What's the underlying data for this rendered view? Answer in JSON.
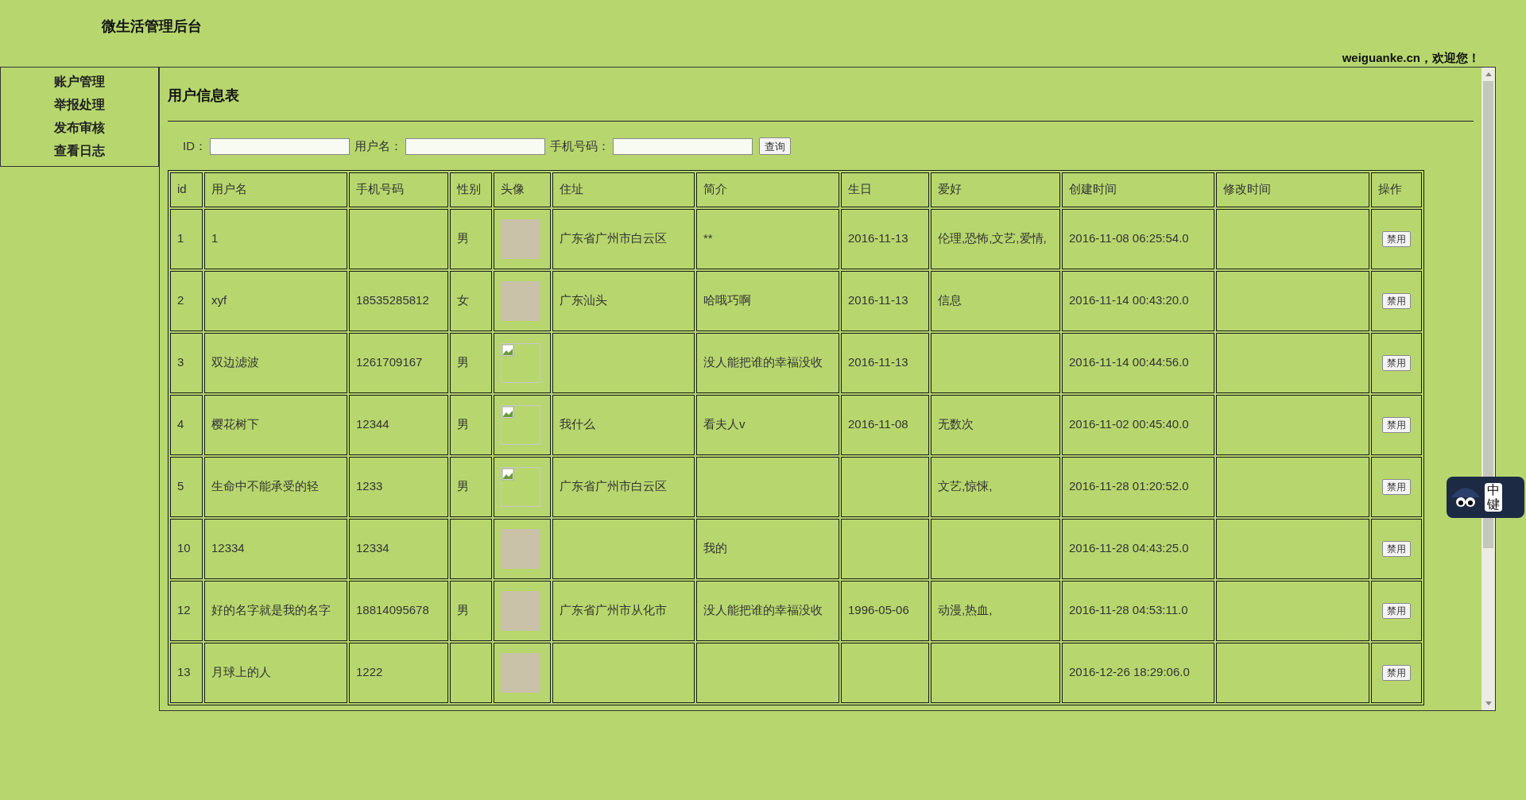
{
  "site_title": "微生活管理后台",
  "welcome": "weiguanke.cn，欢迎您！",
  "sidebar": {
    "items": [
      {
        "label": "账户管理"
      },
      {
        "label": "举报处理"
      },
      {
        "label": "发布审核"
      },
      {
        "label": "查看日志"
      }
    ]
  },
  "page_title": "用户信息表",
  "search": {
    "fields": [
      {
        "label": "ID："
      },
      {
        "label": "用户名："
      },
      {
        "label": "手机号码："
      }
    ],
    "button": "查询"
  },
  "table": {
    "columns": [
      "id",
      "用户名",
      "手机号码",
      "性别",
      "头像",
      "住址",
      "简介",
      "生日",
      "爱好",
      "创建时间",
      "修改时间",
      "操作"
    ],
    "rows": [
      {
        "id": "1",
        "name": "1",
        "phone": "",
        "gender": "男",
        "avatar": {
          "kind": "photo"
        },
        "address": "广东省广州市白云区",
        "intro": "**",
        "birthday": "2016-11-13",
        "hobby": "伦理,恐怖,文艺,爱情,",
        "created": "2016-11-08 06:25:54.0",
        "modified": "",
        "action": "禁用"
      },
      {
        "id": "2",
        "name": "xyf",
        "phone": "18535285812",
        "gender": "女",
        "avatar": {
          "kind": "photo"
        },
        "address": "广东汕头",
        "intro": "哈哦巧啊",
        "birthday": "2016-11-13",
        "hobby": "信息",
        "created": "2016-11-14 00:43:20.0",
        "modified": "",
        "action": "禁用"
      },
      {
        "id": "3",
        "name": "双边滤波",
        "phone": "1261709167",
        "gender": "男",
        "avatar": {
          "kind": "broken"
        },
        "address": "",
        "intro": "没人能把谁的幸福没收",
        "birthday": "2016-11-13",
        "hobby": "",
        "created": "2016-11-14 00:44:56.0",
        "modified": "",
        "action": "禁用"
      },
      {
        "id": "4",
        "name": "樱花树下",
        "phone": "12344",
        "gender": "男",
        "avatar": {
          "kind": "broken"
        },
        "address": "我什么",
        "intro": "看夫人v",
        "birthday": "2016-11-08",
        "hobby": "无数次",
        "created": "2016-11-02 00:45:40.0",
        "modified": "",
        "action": "禁用"
      },
      {
        "id": "5",
        "name": "生命中不能承受的轻",
        "phone": "1233",
        "gender": "男",
        "avatar": {
          "kind": "broken"
        },
        "address": "广东省广州市白云区",
        "intro": "",
        "birthday": "",
        "hobby": "文艺,惊悚,",
        "created": "2016-11-28 01:20:52.0",
        "modified": "",
        "action": "禁用"
      },
      {
        "id": "10",
        "name": "12334",
        "phone": "12334",
        "gender": "",
        "avatar": {
          "kind": "photo"
        },
        "address": "",
        "intro": "我的",
        "birthday": "",
        "hobby": "",
        "created": "2016-11-28 04:43:25.0",
        "modified": "",
        "action": "禁用"
      },
      {
        "id": "12",
        "name": "好的名字就是我的名字",
        "phone": "18814095678",
        "gender": "男",
        "avatar": {
          "kind": "photo"
        },
        "address": "广东省广州市从化市",
        "intro": "没人能把谁的幸福没收",
        "birthday": "1996-05-06",
        "hobby": "动漫,热血,",
        "created": "2016-11-28 04:53:11.0",
        "modified": "",
        "action": "禁用"
      },
      {
        "id": "13",
        "name": "月球上的人",
        "phone": "1222",
        "gender": "",
        "avatar": {
          "kind": "photo"
        },
        "address": "",
        "intro": "",
        "birthday": "",
        "hobby": "",
        "created": "2016-12-26 18:29:06.0",
        "modified": "",
        "action": "禁用"
      }
    ]
  },
  "ime_toolbar": {
    "mode": "中",
    "key": "键"
  }
}
